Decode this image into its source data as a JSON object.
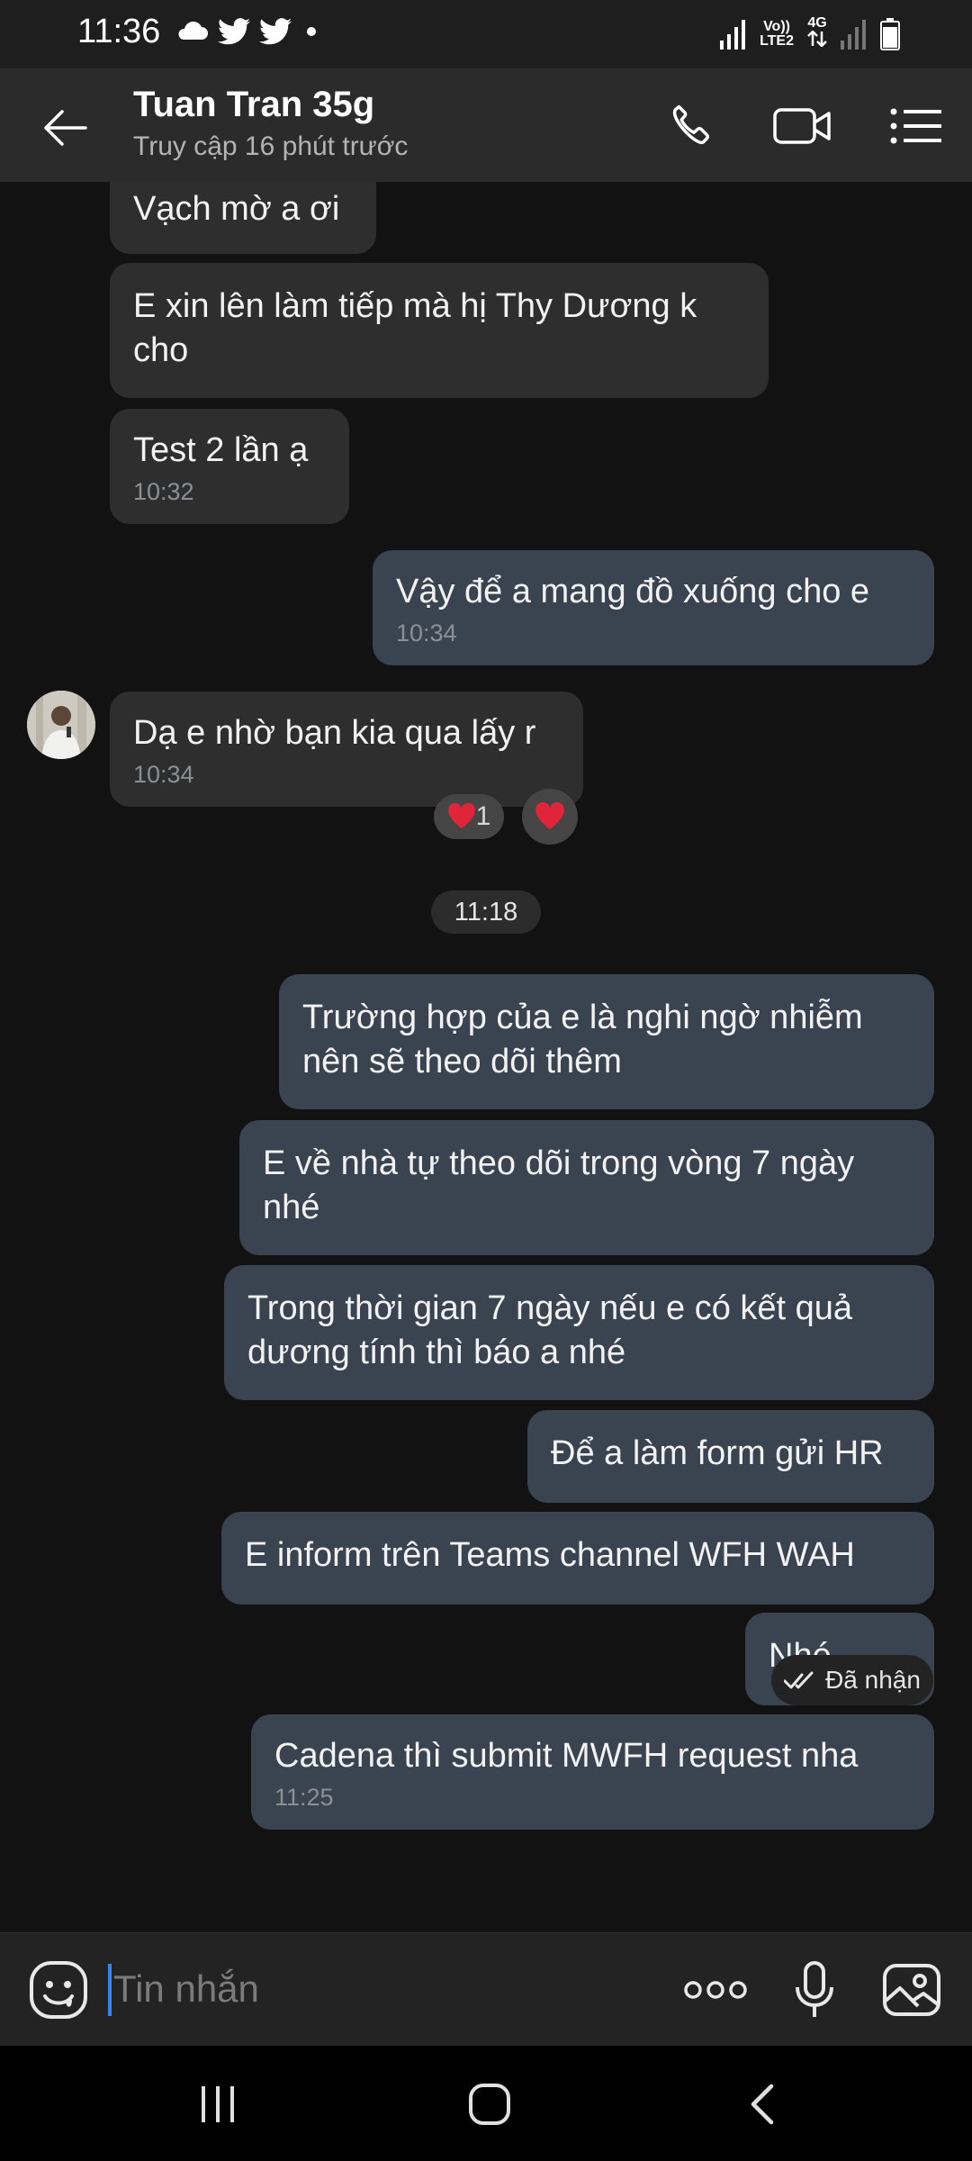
{
  "status_bar": {
    "time": "11:36",
    "network_volte": "Vo))",
    "network_lte": "LTE2",
    "network_4g": "4G",
    "icons": [
      "cloud-icon",
      "twitter-icon",
      "twitter-icon",
      "dot-icon",
      "signal-icon",
      "signal-icon",
      "battery-icon"
    ]
  },
  "header": {
    "contact_name": "Tuan Tran 35g",
    "contact_status": "Truy cập 16 phút trước",
    "icons": [
      "back-arrow-icon",
      "phone-icon",
      "video-call-icon",
      "menu-list-icon"
    ]
  },
  "messages": [
    {
      "direction": "in",
      "text": "Vạch mờ a ơi"
    },
    {
      "direction": "in",
      "text": "E xin lên làm tiếp mà hị Thy Dương k cho"
    },
    {
      "direction": "in",
      "text": "Test 2 lần ạ",
      "time": "10:32"
    },
    {
      "direction": "out",
      "text": "Vậy để a mang đồ xuống cho e",
      "time": "10:34"
    },
    {
      "direction": "in",
      "text": "Dạ e nhờ bạn kia qua lấy r",
      "time": "10:34"
    },
    {
      "direction": "out",
      "text": "Trường hợp của e là nghi ngờ nhiễm nên sẽ theo dõi thêm"
    },
    {
      "direction": "out",
      "text": "E về nhà tự theo dõi trong vòng 7 ngày nhé"
    },
    {
      "direction": "out",
      "text": "Trong thời gian 7 ngày nếu e có kết quả dương tính thì báo a nhé"
    },
    {
      "direction": "out",
      "text": "Để a làm form gửi HR"
    },
    {
      "direction": "out",
      "text": "E inform trên Teams channel WFH WAH"
    },
    {
      "direction": "out",
      "text": "Nhé"
    },
    {
      "direction": "out",
      "text": "Cadena thì submit MWFH request nha",
      "time": "11:25"
    }
  ],
  "reactions": {
    "count_label": "1",
    "heart_color": "#e0253a"
  },
  "time_separator": "11:18",
  "delivery_status": "Đã nhận",
  "input": {
    "placeholder": "Tin nhắn",
    "icons": [
      "emoji-icon",
      "more-options-icon",
      "microphone-icon",
      "image-icon"
    ]
  },
  "nav": {
    "icons": [
      "recent-apps-icon",
      "home-icon",
      "back-icon"
    ]
  },
  "colors": {
    "incoming_bubble": "#2e2e2e",
    "outgoing_bubble": "#3a4350",
    "cursor": "#2f86ff"
  }
}
